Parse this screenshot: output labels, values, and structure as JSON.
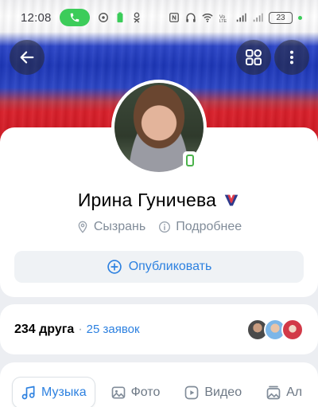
{
  "status_bar": {
    "time": "12:08",
    "battery": "23"
  },
  "profile": {
    "name": "Ирина Гуничева",
    "location": "Сызрань",
    "details_label": "Подробнее",
    "publish_label": "Опубликовать"
  },
  "friends": {
    "count_label": "234 друга",
    "separator": "·",
    "requests_label": "25 заявок"
  },
  "tabs": [
    {
      "label": "Музыка",
      "icon": "music-icon",
      "active": true
    },
    {
      "label": "Фото",
      "icon": "photo-icon",
      "active": false
    },
    {
      "label": "Видео",
      "icon": "video-icon",
      "active": false
    },
    {
      "label": "Ал",
      "icon": "album-icon",
      "active": false
    }
  ],
  "colors": {
    "accent": "#2d81e0",
    "online": "#4bb34b",
    "call_pill": "#3ccc5a"
  }
}
